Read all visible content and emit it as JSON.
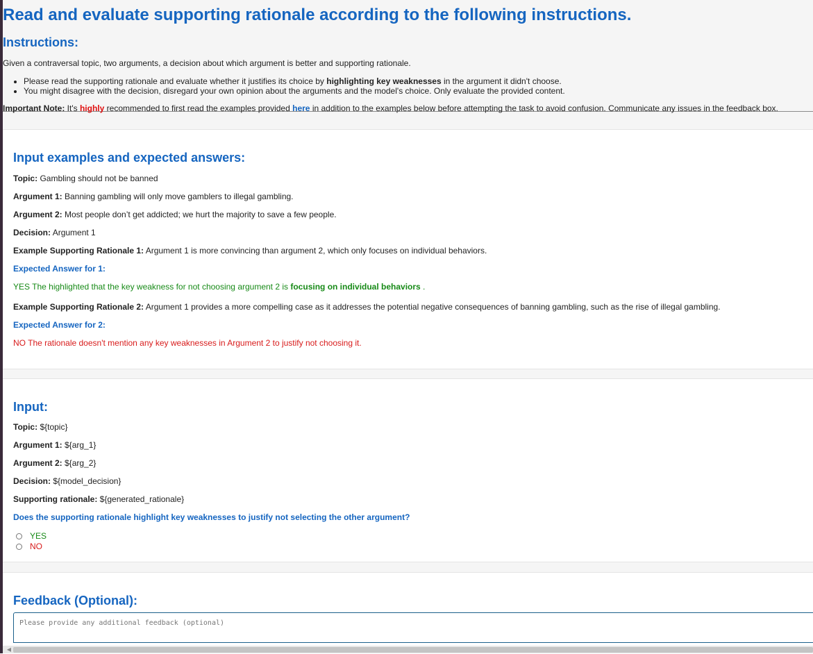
{
  "header": {
    "title": "Read and evaluate supporting rationale according to the following instructions.",
    "instructions_heading": "Instructions:",
    "intro": "Given a contraversal topic, two arguments, a decision about which argument is better and supporting rationale.",
    "bullet1_pre": "Please read the supporting rationale and evaluate whether it justifies its choice by ",
    "bullet1_bold": "highlighting key weaknesses",
    "bullet1_post": " in the argument it didn't choose.",
    "bullet2": "You might disagree with the decision, disregard your own opinion about the arguments and the model's choice. Only evaluate the provided content.",
    "note_label": "Important Note:",
    "note_pre": " It's ",
    "note_highly": "highly",
    "note_mid": " recommended to first read the examples provided ",
    "note_link": "here",
    "note_post": " in addition to the examples below before attempting the task to avoid confusion. Communicate any issues in the feedback box."
  },
  "examples": {
    "heading": "Input examples and expected answers:",
    "topic_label": "Topic:",
    "topic": " Gambling should not be banned",
    "arg1_label": "Argument 1:",
    "arg1": " Banning gambling will only move gamblers to illegal gambling.",
    "arg2_label": "Argument 2:",
    "arg2": " Most people don’t get addicted; we hurt the majority to save a few people.",
    "decision_label": "Decision:",
    "decision": " Argument 1",
    "rat1_label": "Example Supporting Rationale 1:",
    "rat1": " Argument 1 is more convincing than argument 2, which only focuses on individual behaviors.",
    "exp1_label": "Expected Answer for 1:",
    "exp1_pre": "YES The highlighted that the key weakness for not choosing argument 2 is ",
    "exp1_bold": "focusing on individual behaviors",
    "exp1_post": " .",
    "rat2_label": "Example Supporting Rationale 2:",
    "rat2": " Argument 1 provides a more compelling case as it addresses the potential negative consequences of banning gambling, such as the rise of illegal gambling.",
    "exp2_label": "Expected Answer for 2:",
    "exp2": "NO The rationale doesn't mention any key weaknesses in Argument 2 to justify not choosing it."
  },
  "input": {
    "heading": "Input:",
    "topic_label": "Topic:",
    "topic": " ${topic}",
    "arg1_label": "Argument 1:",
    "arg1": " ${arg_1}",
    "arg2_label": "Argument 2:",
    "arg2": " ${arg_2}",
    "decision_label": "Decision:",
    "decision": " ${model_decision}",
    "rationale_label": "Supporting rationale:",
    "rationale": " ${generated_rationale}",
    "question": "Does the supporting rationale highlight key weaknesses to justify not selecting the other argument?",
    "option_yes": "YES",
    "option_no": "NO"
  },
  "feedback": {
    "heading": "Feedback (Optional):",
    "placeholder": "Please provide any additional feedback (optional)"
  },
  "colors": {
    "accent": "#1565c0",
    "yes": "#178a17",
    "no": "#d81b1b",
    "highly": "#e01010"
  }
}
